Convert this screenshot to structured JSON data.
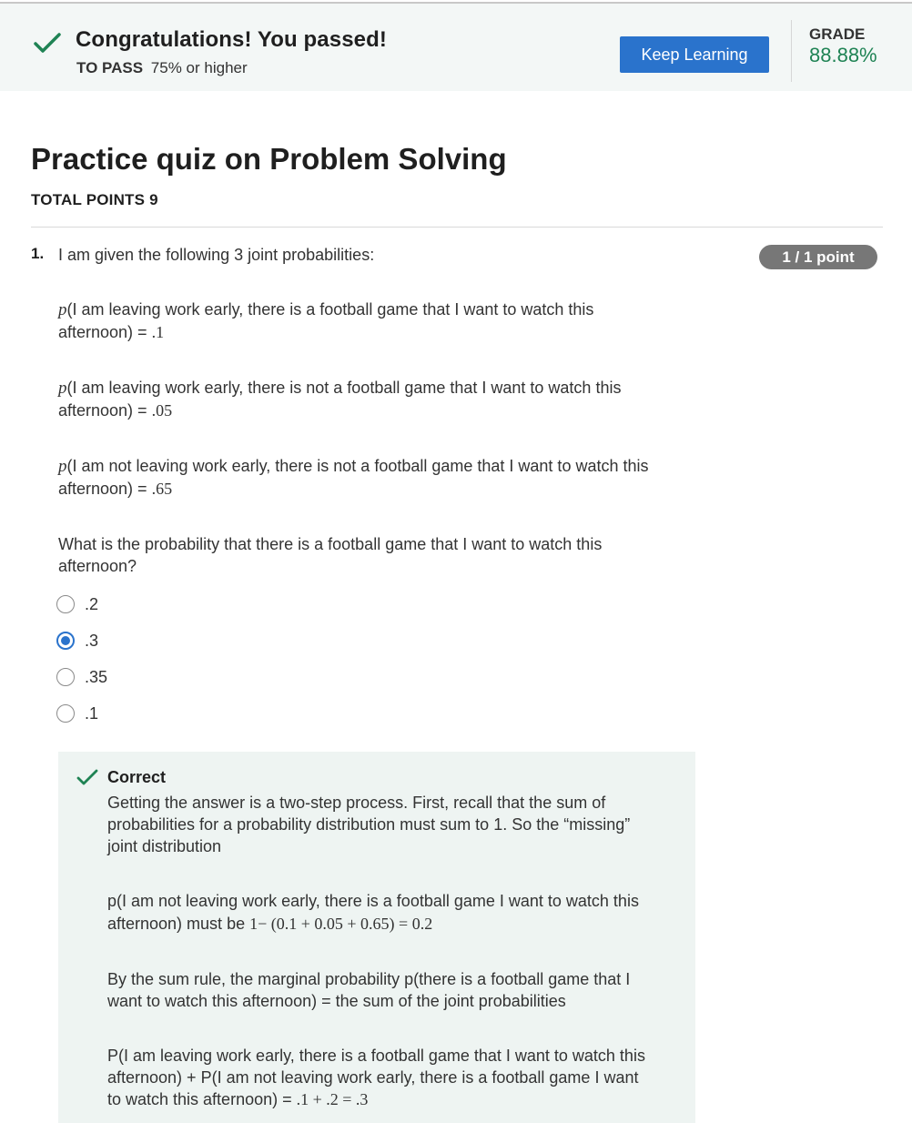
{
  "banner": {
    "title": "Congratulations! You passed!",
    "to_pass_label": "TO PASS",
    "to_pass_value": "75% or higher",
    "keep_learning_label": "Keep Learning",
    "grade_label": "GRADE",
    "grade_value": "88.88%",
    "check_icon": "check-icon",
    "accent_color": "#2a73cc",
    "success_color": "#1f8354"
  },
  "quiz": {
    "title": "Practice quiz on Problem Solving",
    "total_points": "TOTAL POINTS 9"
  },
  "question": {
    "number": "1.",
    "prompt": "I am given the following 3 joint probabilities:",
    "points": "1 / 1 point",
    "joint_probabilities": [
      {
        "p": "p",
        "text_a": "(I am leaving work early, there is a football game that I want to watch this",
        "text_b": "afternoon) = ",
        "value": ".1"
      },
      {
        "p": "p",
        "text_a": "(I am leaving work early, there is not a football game that I want to watch this",
        "text_b": "afternoon) = ",
        "value": ".05"
      },
      {
        "p": "p",
        "text_a": "(I am not leaving work early, there is not a football game that I want to watch this",
        "text_b": "afternoon) = ",
        "value": ".65"
      }
    ],
    "ask_a": "What is the probability that there is a football game that I want to watch this",
    "ask_b": "afternoon?",
    "options": [
      {
        "label": ".2",
        "selected": false
      },
      {
        "label": ".3",
        "selected": true
      },
      {
        "label": ".35",
        "selected": false
      },
      {
        "label": ".1",
        "selected": false
      }
    ]
  },
  "feedback": {
    "title": "Correct",
    "para1": [
      "Getting the answer is a two-step process. First, recall that the sum of",
      "probabilities for a probability distribution must sum to 1. So the “missing”",
      "joint distribution"
    ],
    "para2_a": "p(I am not leaving work early, there is a football game I want to watch this",
    "para2_b": "afternoon) must be ",
    "para2_math": "1− (0.1 + 0.05 + 0.65) = 0.2",
    "para3": [
      "By the sum rule, the marginal probability p(there is a football game that I",
      "want to watch this afternoon) = the sum of the joint probabilities"
    ],
    "para4": [
      "P(I am leaving work early, there is a football game that I want to watch this",
      "afternoon) + P(I am not leaving work early, there is a football game I want"
    ],
    "para4_c": "to watch this afternoon) = ",
    "para4_math": ".1 + .2 = .3"
  }
}
